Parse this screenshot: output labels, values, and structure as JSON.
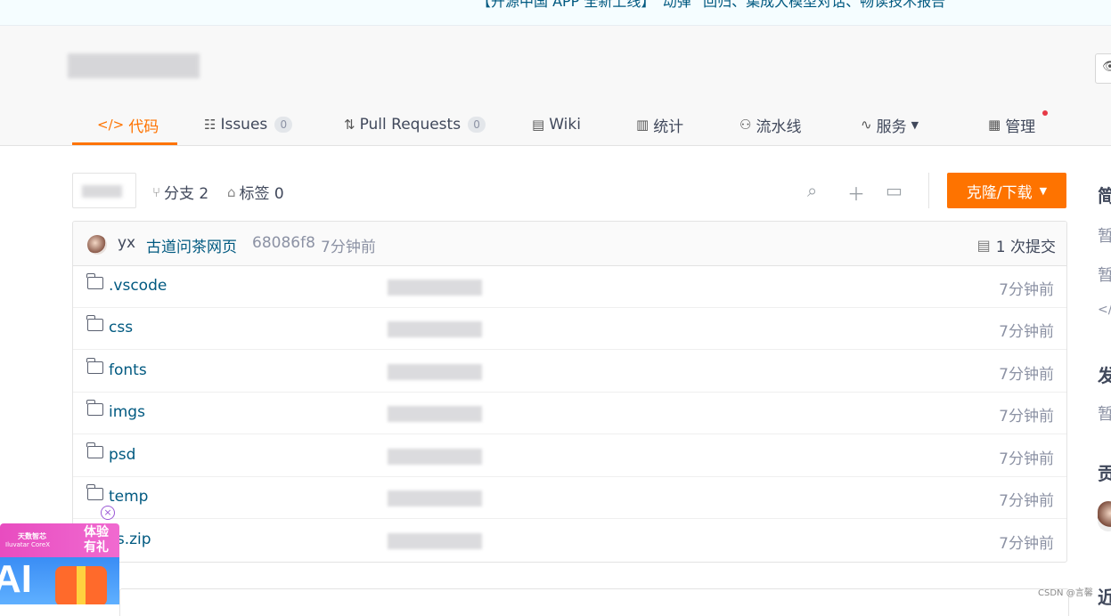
{
  "banner": {
    "text": "【开源中国 APP 全新上线】“动弹” 回归、集成大模型对话、畅读技术报告"
  },
  "tabs": [
    {
      "icon": "</>",
      "label": "代码",
      "count": ""
    },
    {
      "icon": "☷",
      "label": "Issues",
      "count": "0"
    },
    {
      "icon": "⇅",
      "label": "Pull Requests",
      "count": "0"
    },
    {
      "icon": "▤",
      "label": "Wiki",
      "count": ""
    },
    {
      "icon": "▥",
      "label": "统计",
      "count": ""
    },
    {
      "icon": "⚇",
      "label": "流水线",
      "count": ""
    },
    {
      "icon": "∿",
      "label": "服务",
      "count": ""
    },
    {
      "icon": "▦",
      "label": "管理",
      "count": ""
    }
  ],
  "toolbar": {
    "branches": "分支 2",
    "tags": "标签 0",
    "clone_label": "克隆/下载"
  },
  "commit": {
    "author": "yx",
    "message": "古道问茶网页",
    "hash": "68086f8",
    "time": "7分钟前",
    "count": "1 次提交"
  },
  "files": [
    {
      "name": ".vscode",
      "time": "7分钟前"
    },
    {
      "name": "css",
      "time": "7分钟前"
    },
    {
      "name": "fonts",
      "time": "7分钟前"
    },
    {
      "name": "imgs",
      "time": "7分钟前"
    },
    {
      "name": "psd",
      "time": "7分钟前"
    },
    {
      "name": "temp",
      "time": "7分钟前"
    },
    {
      "name": "ss.zip",
      "time": "7分钟前"
    }
  ],
  "sidebar": {
    "h1": "简",
    "t1": "暂",
    "t2": "暂",
    "t3": "</",
    "h2": "发",
    "t4": "暂",
    "h3": "贡",
    "h4": "近"
  },
  "ad": {
    "brand1": "天数智芯",
    "brand2": "Iluvatar CoreX",
    "cta": "体验 有礼",
    "ai": "AI",
    "close": "×"
  },
  "watermark": "CSDN @言馨",
  "colors": {
    "accent": "#fe7300",
    "link": "#005980",
    "muted": "#8c92a4"
  }
}
